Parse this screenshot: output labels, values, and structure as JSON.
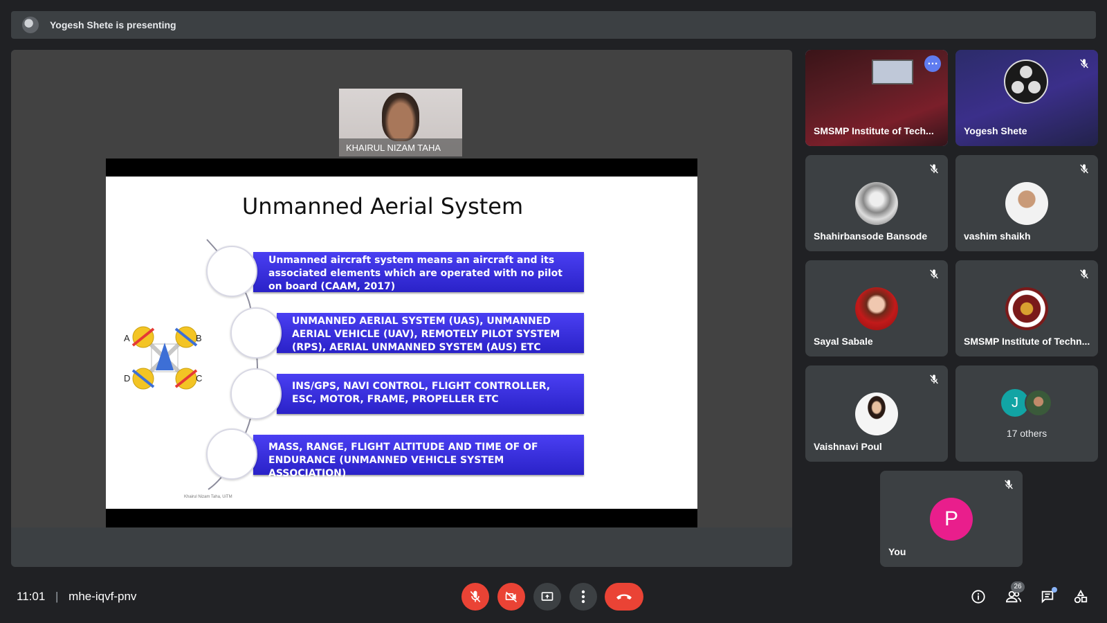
{
  "banner": {
    "text": "Yogesh Shete is presenting"
  },
  "stage": {
    "camera_name": "KHAIRUL NIZAM TAHA",
    "slide": {
      "title": "Unmanned Aerial System",
      "bullets": [
        "Unmanned aircraft system means an aircraft and its associated elements which are operated with no pilot on board (CAAM, 2017)",
        "UNMANNED AERIAL SYSTEM (UAS), UNMANNED AERIAL VEHICLE (UAV), REMOTELY PILOT SYSTEM (RPS), AERIAL UNMANNED SYSTEM (AUS) ETC",
        "INS/GPS, NAVI CONTROL, FLIGHT CONTROLLER, ESC, MOTOR, FRAME, PROPELLER ETC",
        "MASS, RANGE, FLIGHT ALTITUDE AND TIME OF OF ENDURANCE (UNMANNED VEHICLE SYSTEM ASSOCIATION)"
      ],
      "drone_labels": {
        "a": "A",
        "b": "B",
        "c": "C",
        "d": "D"
      },
      "footer": "Khairul Nizam Taha, UiTM"
    }
  },
  "participants": [
    {
      "name": "SMSMP Institute of Tech...",
      "muted": false,
      "active": true
    },
    {
      "name": "Yogesh Shete",
      "muted": true
    },
    {
      "name": "Shahirbansode Bansode",
      "muted": true
    },
    {
      "name": "vashim shaikh",
      "muted": true
    },
    {
      "name": "Sayal Sabale",
      "muted": true
    },
    {
      "name": "SMSMP Institute of Techn...",
      "muted": true
    },
    {
      "name": "Vaishnavi Poul",
      "muted": true
    },
    {
      "name": "You",
      "initial": "P",
      "muted": true
    }
  ],
  "others": {
    "initial": "J",
    "label": "17 others"
  },
  "controls": {
    "time": "11:01",
    "separator": "|",
    "meeting_code": "mhe-iqvf-pnv",
    "participant_count": "26"
  },
  "colors": {
    "background": "#202124",
    "tile": "#3c4043",
    "danger": "#ea4335",
    "accent": "#8ab4f8",
    "you_avatar": "#e91e8c"
  }
}
